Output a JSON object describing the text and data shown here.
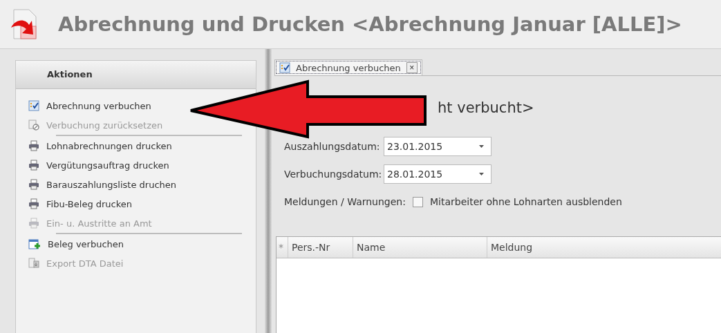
{
  "window": {
    "title": "Abrechnung und Drucken <Abrechnung Januar [ALLE]>"
  },
  "actions_panel": {
    "title": "Aktionen",
    "items": [
      {
        "label": "Abrechnung verbuchen",
        "kind": "checklist",
        "disabled": false,
        "separator_after": false
      },
      {
        "label": "Verbuchung zurücksetzen",
        "kind": "reset",
        "disabled": true,
        "separator_after": true
      },
      {
        "label": "Lohnabrechnungen drucken",
        "kind": "printer",
        "disabled": false,
        "separator_after": false
      },
      {
        "label": "Vergütungsauftrag drucken",
        "kind": "printer",
        "disabled": false,
        "separator_after": false
      },
      {
        "label": "Barauszahlungsliste druchen",
        "kind": "printer",
        "disabled": false,
        "separator_after": false
      },
      {
        "label": "Fibu-Beleg drucken",
        "kind": "printer",
        "disabled": false,
        "separator_after": false
      },
      {
        "label": "Ein- u. Austritte an Amt",
        "kind": "printer",
        "disabled": true,
        "separator_after": true
      },
      {
        "label": "Beleg verbuchen",
        "kind": "calendar",
        "disabled": false,
        "separator_after": false
      },
      {
        "label": "Export DTA Datei",
        "kind": "export",
        "disabled": true,
        "separator_after": false
      }
    ]
  },
  "tabs": [
    {
      "label": "Abrechnung verbuchen",
      "selected": true,
      "close": "×"
    }
  ],
  "status_heading": "ht verbucht>",
  "fields": [
    {
      "label": "Auszahlungsdatum:",
      "value": "23.01.2015"
    },
    {
      "label": "Verbuchungsdatum:",
      "value": "28.01.2015"
    }
  ],
  "messages": {
    "label": "Meldungen / Warnungen:",
    "checkbox": {
      "label": "Mitarbeiter ohne Lohnarten ausblenden",
      "checked": false
    }
  },
  "table": {
    "marker": "*",
    "columns": [
      "Pers.-Nr",
      "Name",
      "Meldung"
    ]
  },
  "annotation": {
    "kind": "arrow"
  }
}
